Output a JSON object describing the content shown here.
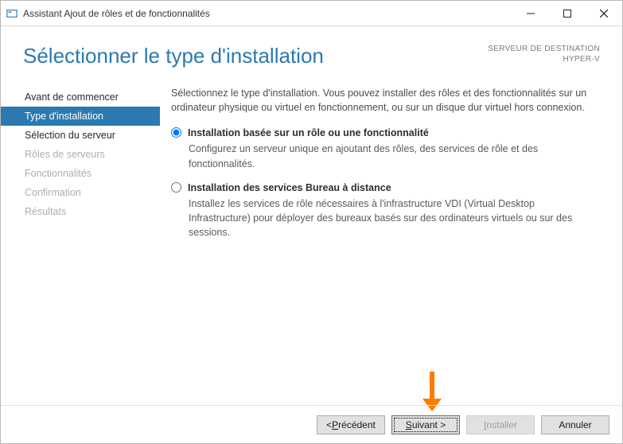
{
  "window": {
    "title": "Assistant Ajout de rôles et de fonctionnalités"
  },
  "header": {
    "title": "Sélectionner le type d'installation",
    "dest_label": "SERVEUR DE DESTINATION",
    "dest_value": "HYPER-V"
  },
  "sidebar": {
    "items": [
      {
        "label": "Avant de commencer",
        "state": "normal"
      },
      {
        "label": "Type d'installation",
        "state": "active"
      },
      {
        "label": "Sélection du serveur",
        "state": "normal"
      },
      {
        "label": "Rôles de serveurs",
        "state": "disabled"
      },
      {
        "label": "Fonctionnalités",
        "state": "disabled"
      },
      {
        "label": "Confirmation",
        "state": "disabled"
      },
      {
        "label": "Résultats",
        "state": "disabled"
      }
    ]
  },
  "main": {
    "intro": "Sélectionnez le type d'installation. Vous pouvez installer des rôles et des fonctionnalités sur un ordinateur physique ou virtuel en fonctionnement, ou sur un disque dur virtuel hors connexion.",
    "option1": {
      "title": "Installation basée sur un rôle ou une fonctionnalité",
      "desc": "Configurez un serveur unique en ajoutant des rôles, des services de rôle et des fonctionnalités."
    },
    "option2": {
      "title": "Installation des services Bureau à distance",
      "desc": "Installez les services de rôle nécessaires à l'infrastructure VDI (Virtual Desktop Infrastructure) pour déployer des bureaux basés sur des ordinateurs virtuels ou sur des sessions."
    }
  },
  "footer": {
    "prev_prefix": "< ",
    "prev_accel": "P",
    "prev_rest": "récédent",
    "next_accel": "S",
    "next_rest": "uivant >",
    "install_accel": "I",
    "install_rest": "nstaller",
    "cancel": "Annuler"
  }
}
